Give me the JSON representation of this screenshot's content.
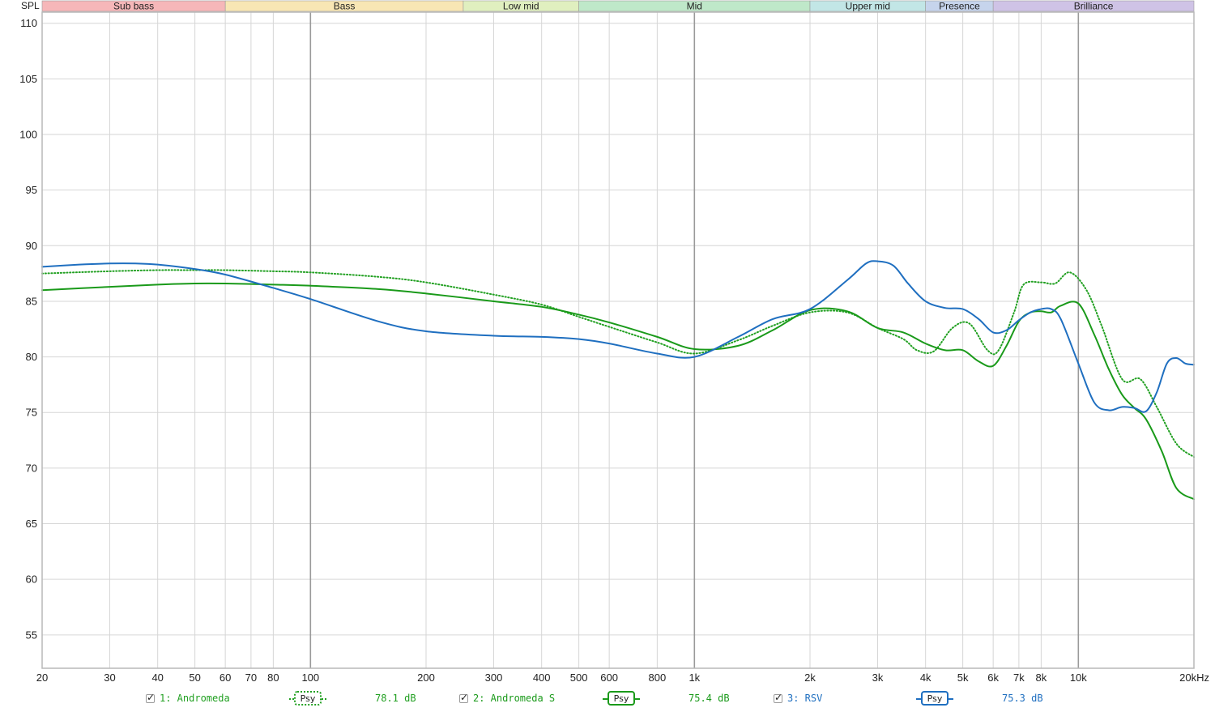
{
  "chart_data": {
    "type": "line",
    "ylabel": "SPL",
    "x_scale": "log",
    "xlim": [
      20,
      20000
    ],
    "ylim": [
      52,
      111
    ],
    "y_ticks": [
      55,
      60,
      65,
      70,
      75,
      80,
      85,
      90,
      95,
      100,
      105,
      110
    ],
    "x_ticks": [
      {
        "value": 20,
        "label": "20"
      },
      {
        "value": 30,
        "label": "30"
      },
      {
        "value": 40,
        "label": "40"
      },
      {
        "value": 50,
        "label": "50"
      },
      {
        "value": 60,
        "label": "60"
      },
      {
        "value": 70,
        "label": "70"
      },
      {
        "value": 80,
        "label": "80"
      },
      {
        "value": 100,
        "label": "100"
      },
      {
        "value": 200,
        "label": "200"
      },
      {
        "value": 300,
        "label": "300"
      },
      {
        "value": 400,
        "label": "400"
      },
      {
        "value": 500,
        "label": "500"
      },
      {
        "value": 600,
        "label": "600"
      },
      {
        "value": 800,
        "label": "800"
      },
      {
        "value": 1000,
        "label": "1k"
      },
      {
        "value": 2000,
        "label": "2k"
      },
      {
        "value": 3000,
        "label": "3k"
      },
      {
        "value": 4000,
        "label": "4k"
      },
      {
        "value": 5000,
        "label": "5k"
      },
      {
        "value": 6000,
        "label": "6k"
      },
      {
        "value": 7000,
        "label": "7k"
      },
      {
        "value": 8000,
        "label": "8k"
      },
      {
        "value": 10000,
        "label": "10k"
      },
      {
        "value": 20000,
        "label": "20kHz"
      }
    ],
    "bands": [
      {
        "label": "Sub bass",
        "from": 20,
        "to": 60,
        "color": "#f6b7b9"
      },
      {
        "label": "Bass",
        "from": 60,
        "to": 250,
        "color": "#f8e6b4"
      },
      {
        "label": "Low mid",
        "from": 250,
        "to": 500,
        "color": "#e0efbf"
      },
      {
        "label": "Mid",
        "from": 500,
        "to": 2000,
        "color": "#bfe8c9"
      },
      {
        "label": "Upper mid",
        "from": 2000,
        "to": 4000,
        "color": "#c2e6e6"
      },
      {
        "label": "Presence",
        "from": 4000,
        "to": 6000,
        "color": "#c6d4ec"
      },
      {
        "label": "Brilliance",
        "from": 6000,
        "to": 20000,
        "color": "#cfc3e6"
      }
    ],
    "grid": true,
    "series": [
      {
        "name": "1: Andromeda",
        "color": "#22a022",
        "style": "dotted",
        "x": [
          20,
          30,
          40,
          50,
          60,
          80,
          100,
          150,
          200,
          300,
          400,
          500,
          600,
          800,
          1000,
          1300,
          1600,
          2000,
          2500,
          3000,
          3500,
          3800,
          4200,
          4700,
          5200,
          5800,
          6200,
          6800,
          7200,
          8000,
          8700,
          9500,
          10500,
          11500,
          13000,
          14500,
          16000,
          18000,
          20000
        ],
        "values": [
          87.5,
          87.7,
          87.8,
          87.8,
          87.8,
          87.7,
          87.6,
          87.2,
          86.7,
          85.6,
          84.7,
          83.6,
          82.7,
          81.3,
          80.3,
          81.5,
          82.8,
          84.0,
          84.0,
          82.6,
          81.6,
          80.6,
          80.5,
          82.6,
          83.0,
          80.6,
          80.6,
          84.0,
          86.5,
          86.7,
          86.6,
          87.6,
          86.0,
          82.8,
          78.0,
          78.0,
          75.5,
          72.2,
          71.0
        ]
      },
      {
        "name": "2: Andromeda S",
        "color": "#1a9a1a",
        "style": "solid",
        "x": [
          20,
          30,
          40,
          50,
          60,
          80,
          100,
          150,
          200,
          300,
          400,
          500,
          600,
          800,
          1000,
          1300,
          1600,
          2000,
          2500,
          3000,
          3500,
          4000,
          4500,
          5000,
          5500,
          6000,
          6500,
          7000,
          7500,
          8000,
          8500,
          9000,
          10000,
          11000,
          12000,
          13000,
          14000,
          15000,
          16500,
          18000,
          20000
        ],
        "values": [
          86.0,
          86.3,
          86.5,
          86.6,
          86.6,
          86.5,
          86.4,
          86.1,
          85.7,
          85.0,
          84.5,
          83.8,
          83.1,
          81.8,
          80.7,
          81.0,
          82.4,
          84.2,
          84.1,
          82.6,
          82.2,
          81.2,
          80.6,
          80.6,
          79.6,
          79.2,
          81.0,
          83.2,
          84.0,
          84.1,
          84.0,
          84.6,
          84.8,
          82.0,
          78.9,
          76.6,
          75.4,
          74.4,
          71.5,
          68.2,
          67.2
        ]
      },
      {
        "name": "3: RSV",
        "color": "#1f6fc0",
        "style": "solid",
        "x": [
          20,
          25,
          30,
          35,
          40,
          50,
          60,
          80,
          100,
          150,
          200,
          300,
          400,
          500,
          600,
          800,
          1000,
          1300,
          1600,
          2000,
          2500,
          2800,
          3000,
          3300,
          3600,
          4000,
          4500,
          5000,
          5500,
          6000,
          6500,
          7000,
          7500,
          8000,
          8500,
          9000,
          10000,
          11000,
          12000,
          13000,
          14000,
          15000,
          16000,
          17000,
          18000,
          19000,
          20000
        ],
        "values": [
          88.1,
          88.3,
          88.4,
          88.4,
          88.3,
          87.9,
          87.4,
          86.2,
          85.2,
          83.2,
          82.3,
          81.9,
          81.8,
          81.6,
          81.2,
          80.3,
          80.0,
          81.8,
          83.4,
          84.3,
          86.9,
          88.4,
          88.6,
          88.2,
          86.6,
          85.0,
          84.4,
          84.3,
          83.4,
          82.2,
          82.4,
          83.3,
          84.0,
          84.3,
          84.3,
          83.4,
          79.4,
          75.9,
          75.2,
          75.5,
          75.4,
          75.1,
          76.8,
          79.4,
          79.9,
          79.4,
          79.3
        ]
      }
    ]
  },
  "legend": [
    {
      "label": "1: Andromeda",
      "psy": "Psy",
      "value": "78.1 dB",
      "color": "#22a022",
      "border_style": "dotted"
    },
    {
      "label": "2: Andromeda S",
      "psy": "Psy",
      "value": "75.4 dB",
      "color": "#1a9a1a",
      "border_style": "solid"
    },
    {
      "label": "3: RSV",
      "psy": "Psy",
      "value": "75.3 dB",
      "color": "#1f6fc0",
      "border_style": "solid"
    }
  ]
}
